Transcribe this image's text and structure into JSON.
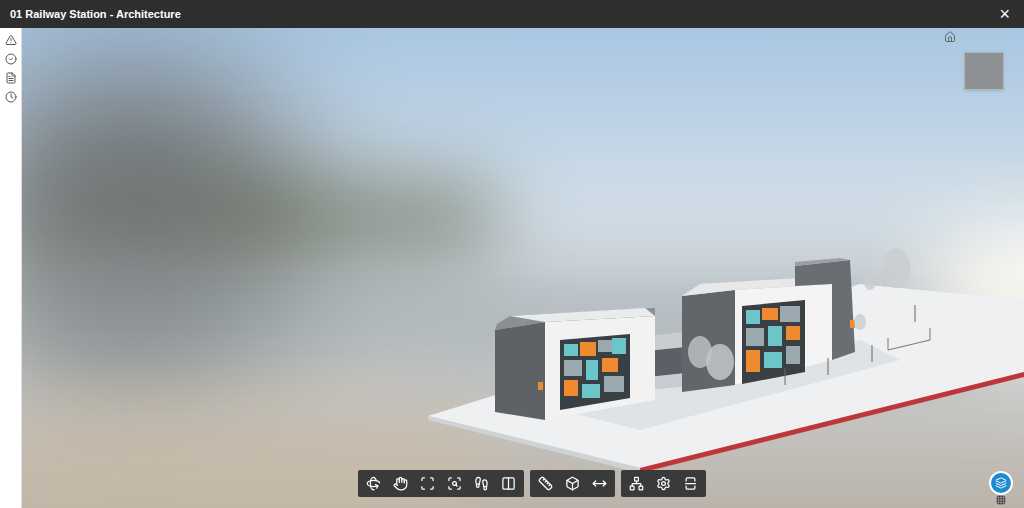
{
  "window": {
    "title": "01 Railway Station - Architecture",
    "close": "×"
  }
}
